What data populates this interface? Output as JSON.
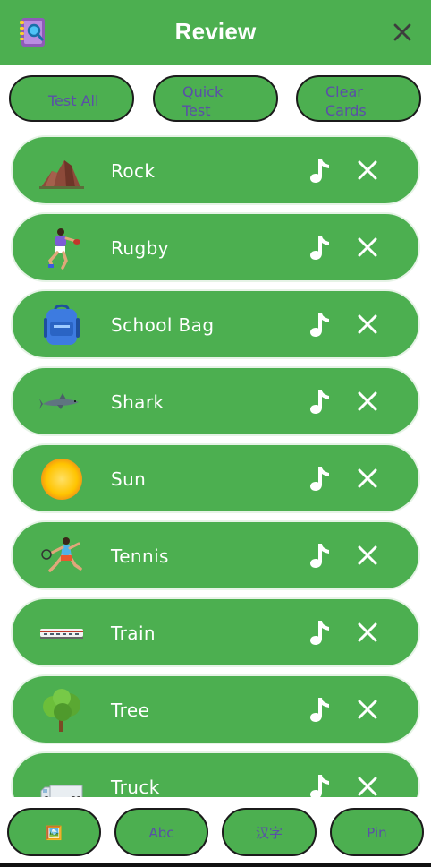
{
  "header": {
    "title": "Review",
    "logo_icon": "notebook-magnifier-icon",
    "close_icon": "close-icon"
  },
  "actions": [
    {
      "label_lines": [
        "Test All"
      ]
    },
    {
      "label_lines": [
        "Quick",
        "Test"
      ]
    },
    {
      "label_lines": [
        "Clear",
        "Cards"
      ]
    }
  ],
  "cards": [
    {
      "word": "Rock",
      "picture": "rock-icon"
    },
    {
      "word": "Rugby",
      "picture": "rugby-player-icon"
    },
    {
      "word": "School Bag",
      "picture": "school-bag-icon"
    },
    {
      "word": "Shark",
      "picture": "shark-icon"
    },
    {
      "word": "Sun",
      "picture": "sun-icon"
    },
    {
      "word": "Tennis",
      "picture": "tennis-player-icon"
    },
    {
      "word": "Train",
      "picture": "train-icon"
    },
    {
      "word": "Tree",
      "picture": "tree-icon"
    },
    {
      "word": "Truck",
      "picture": "truck-icon"
    }
  ],
  "bottom_nav": [
    {
      "label": "🖼️",
      "name": "picture-mode"
    },
    {
      "label": "Abc",
      "name": "abc-mode"
    },
    {
      "label": "汉字",
      "name": "hanzi-mode"
    },
    {
      "label": "Pin",
      "name": "pin-mode"
    }
  ],
  "colors": {
    "primary": "#4caf50",
    "button_text": "#5a4fa8",
    "card_border": "#e6f3e6"
  }
}
